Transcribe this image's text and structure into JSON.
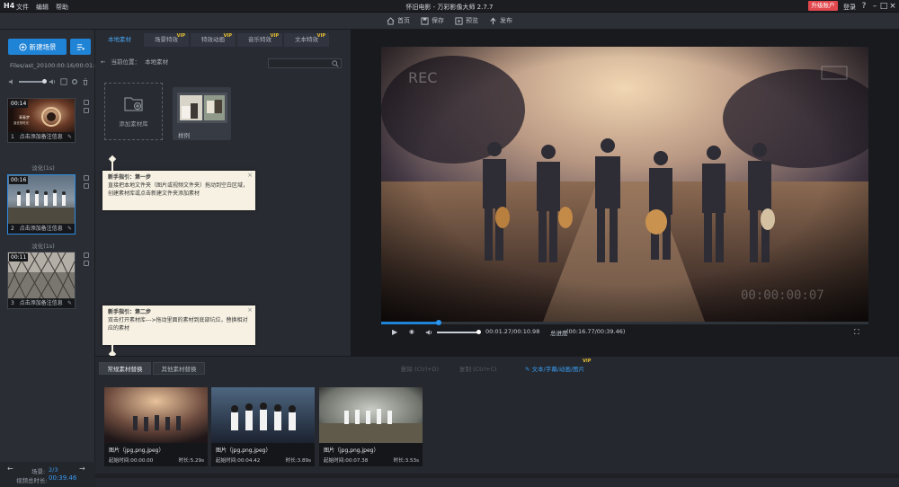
{
  "titlebar": {
    "logo": "H4",
    "menu": [
      "文件",
      "编辑",
      "帮助"
    ],
    "title": "怀旧电影 - 万彩影像大师 2.7.7",
    "upgrade": "升级账户",
    "login": "登录",
    "win_buttons": [
      "?",
      "–",
      "□",
      "×"
    ]
  },
  "toolbar": {
    "home": "首页",
    "save": "保存",
    "preview": "预览",
    "publish": "发布"
  },
  "left": {
    "new_scene": "新建场景",
    "file": "Files/ast_201",
    "time": "00:00:16/00:01:59",
    "scenes": [
      {
        "duration": "00:14",
        "index": "1",
        "label": "点击添加备注信息"
      },
      {
        "duration": "00:16",
        "index": "2",
        "label": "点击添加备注信息"
      },
      {
        "duration": "00:11",
        "index": "3",
        "label": "点击添加备注信息"
      }
    ],
    "transitions": [
      "淡化(1s)",
      "淡化(1s)"
    ],
    "scene_counter_label": "场景:",
    "scene_counter": "2/3",
    "total_time_label": "视频总时长:",
    "total_time": "00:39.46"
  },
  "mid": {
    "tabs": [
      {
        "label": "本地素材",
        "badge": ""
      },
      {
        "label": "场景特效",
        "badge": "VIP"
      },
      {
        "label": "特效动画",
        "badge": "VIP"
      },
      {
        "label": "音乐特效",
        "badge": "VIP"
      },
      {
        "label": "文本特效",
        "badge": "VIP"
      }
    ],
    "path_label": "当前位置：",
    "path_value": "本地素材",
    "add_library": "添加素材库",
    "folder_label": "样例",
    "guide1": {
      "title": "新手指引：第一步",
      "body": "直接把本地文件夹（图片或视频文件夹）拖动到空白区域，创建素材库或点击新建文件夹添加素材"
    },
    "guide2": {
      "title": "新手指引：第二步",
      "body": "双击打开素材库--->拖动里面的素材到底部坑位，替换相对应的素材"
    }
  },
  "preview": {
    "watermark_rec": "REC",
    "watermark_time": "00:00:00:07",
    "progress": 0.118,
    "current_time": "00:01.27/00:10.98",
    "total_label": "总进度",
    "total_time": "(00:16.77/00:39.46)"
  },
  "bottom": {
    "tabs": [
      "常规素材替换",
      "其他素材替换"
    ],
    "actions": [
      "删除 (Ctrl+D)",
      "复制 (Ctrl+C)",
      "文本/字幕/动画/图片"
    ],
    "actions_badge": "VIP",
    "cards": [
      {
        "type": "图片（jpg,png,jpeg）",
        "start": "起始时间:00:00.00",
        "duration": "时长:5.29s"
      },
      {
        "type": "图片（jpg,png,jpeg）",
        "start": "起始时间:00:04.42",
        "duration": "时长:3.89s"
      },
      {
        "type": "图片（jpg,png,jpeg）",
        "start": "起始时间:00:07.38",
        "duration": "时长:3.53s"
      }
    ]
  },
  "colors": {
    "accent": "#1f83d6",
    "upgrade": "#e2474d",
    "vip": "#e8c033"
  }
}
